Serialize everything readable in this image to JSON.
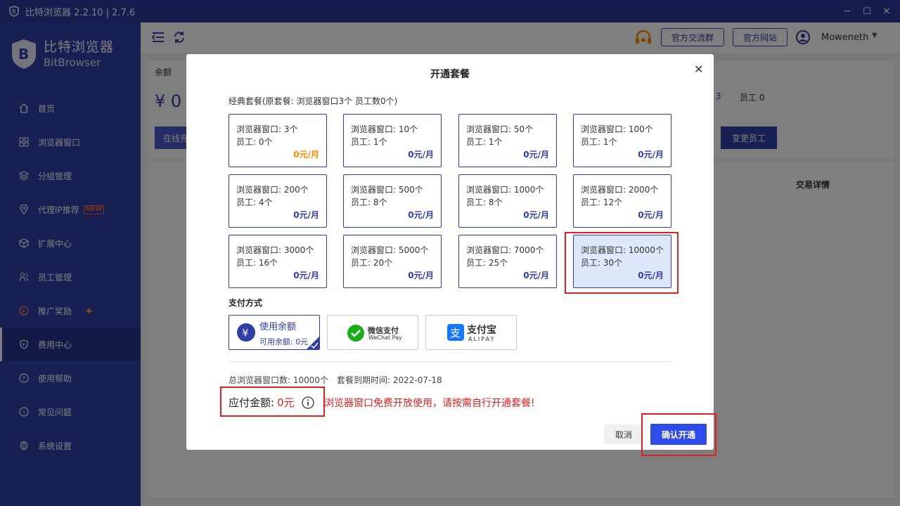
{
  "window": {
    "title": "比特浏览器 2.2.10 | 2.7.6"
  },
  "brand": {
    "cn": "比特浏览器",
    "en": "BitBrowser"
  },
  "sidebar": {
    "items": [
      {
        "label": "首页",
        "icon": "home-icon"
      },
      {
        "label": "浏览器窗口",
        "icon": "grid-icon"
      },
      {
        "label": "分组管理",
        "icon": "layers-icon"
      },
      {
        "label": "代理IP推荐",
        "icon": "location-icon",
        "badge": "NEW"
      },
      {
        "label": "扩展中心",
        "icon": "cube-icon"
      },
      {
        "label": "员工管理",
        "icon": "users-icon"
      },
      {
        "label": "推广奖励",
        "icon": "reward-icon"
      },
      {
        "label": "费用中心",
        "icon": "shield-icon",
        "active": true
      },
      {
        "label": "使用帮助",
        "icon": "help-icon"
      },
      {
        "label": "常见问题",
        "icon": "info-icon"
      },
      {
        "label": "系统设置",
        "icon": "gear-icon"
      }
    ]
  },
  "topbar": {
    "group_btn": "官方交流群",
    "site_btn": "官方网站",
    "username": "Moweneth"
  },
  "background": {
    "balance_label": "余额",
    "balance_value": "¥ 0",
    "online_btn": "在线充",
    "windows_partial": "3",
    "staff_label": "员工 0",
    "change_staff_btn": "变更员工",
    "trade_detail": "交易详情"
  },
  "modal": {
    "title": "开通套餐",
    "classic_label": "经典套餐(原套餐: 浏览器窗口3个 员工数0个)",
    "plans": [
      {
        "windows": "浏览器窗口: 3个",
        "staff": "员工: 0个",
        "price": "0元/月"
      },
      {
        "windows": "浏览器窗口: 10个",
        "staff": "员工: 1个",
        "price": "0元/月"
      },
      {
        "windows": "浏览器窗口: 50个",
        "staff": "员工: 1个",
        "price": "0元/月"
      },
      {
        "windows": "浏览器窗口: 100个",
        "staff": "员工: 1个",
        "price": "0元/月"
      },
      {
        "windows": "浏览器窗口: 200个",
        "staff": "员工: 4个",
        "price": "0元/月"
      },
      {
        "windows": "浏览器窗口: 500个",
        "staff": "员工: 8个",
        "price": "0元/月"
      },
      {
        "windows": "浏览器窗口: 1000个",
        "staff": "员工: 8个",
        "price": "0元/月"
      },
      {
        "windows": "浏览器窗口: 2000个",
        "staff": "员工: 12个",
        "price": "0元/月"
      },
      {
        "windows": "浏览器窗口: 3000个",
        "staff": "员工: 16个",
        "price": "0元/月"
      },
      {
        "windows": "浏览器窗口: 5000个",
        "staff": "员工: 20个",
        "price": "0元/月"
      },
      {
        "windows": "浏览器窗口: 7000个",
        "staff": "员工: 25个",
        "price": "0元/月"
      },
      {
        "windows": "浏览器窗口: 10000个",
        "staff": "员工: 30个",
        "price": "0元/月"
      }
    ],
    "pay_title": "支付方式",
    "pay_balance": {
      "title": "使用余额",
      "sub": "可用余额: 0元"
    },
    "pay_wechat": {
      "cn": "微信支付",
      "en": "WeChat Pay"
    },
    "pay_alipay": {
      "cn": "支付宝",
      "en": "ALIPAY"
    },
    "total_windows": "总浏览器窗口数: 10000个",
    "expire": "套餐到期时间: 2022-07-18",
    "amount_label": "应付金额:",
    "amount_value": "0元",
    "notice": "浏览器窗口免费开放使用，请按需自行开通套餐!",
    "cancel": "取消",
    "confirm": "确认开通"
  },
  "colors": {
    "primary": "#2f3ea7",
    "accent": "#2f4bea",
    "danger": "#e02020",
    "orange": "#ff8c00"
  }
}
